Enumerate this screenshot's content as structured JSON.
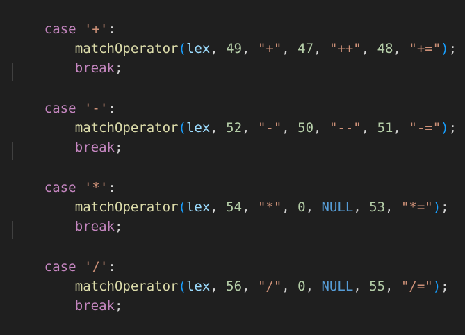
{
  "code": {
    "blocks": [
      {
        "case_keyword": "case",
        "case_char": "'+'",
        "colon": ":",
        "call": {
          "fn": "matchOperator",
          "open": "(",
          "arg1": "lex",
          "sep1": ", ",
          "n1": "49",
          "sep2": ", ",
          "s1": "\"+\"",
          "sep3": ", ",
          "n2": "47",
          "sep4": ", ",
          "s2": "\"++\"",
          "sep5": ", ",
          "n3": "48",
          "sep6": ", ",
          "s3": "\"+=\"",
          "close": ")",
          "semi": ";"
        },
        "break_keyword": "break",
        "break_semi": ";"
      },
      {
        "case_keyword": "case",
        "case_char": "'-'",
        "colon": ":",
        "call": {
          "fn": "matchOperator",
          "open": "(",
          "arg1": "lex",
          "sep1": ", ",
          "n1": "52",
          "sep2": ", ",
          "s1": "\"-\"",
          "sep3": ", ",
          "n2": "50",
          "sep4": ", ",
          "s2": "\"--\"",
          "sep5": ", ",
          "n3": "51",
          "sep6": ", ",
          "s3": "\"-=\"",
          "close": ")",
          "semi": ";"
        },
        "break_keyword": "break",
        "break_semi": ";"
      },
      {
        "case_keyword": "case",
        "case_char": "'*'",
        "colon": ":",
        "call": {
          "fn": "matchOperator",
          "open": "(",
          "arg1": "lex",
          "sep1": ", ",
          "n1": "54",
          "sep2": ", ",
          "s1": "\"*\"",
          "sep3": ", ",
          "n2": "0",
          "sep4": ", ",
          "s2": "NULL",
          "sep5": ", ",
          "n3": "53",
          "sep6": ", ",
          "s3": "\"*=\"",
          "close": ")",
          "semi": ";"
        },
        "break_keyword": "break",
        "break_semi": ";"
      },
      {
        "case_keyword": "case",
        "case_char": "'/'",
        "colon": ":",
        "call": {
          "fn": "matchOperator",
          "open": "(",
          "arg1": "lex",
          "sep1": ", ",
          "n1": "56",
          "sep2": ", ",
          "s1": "\"/\"",
          "sep3": ", ",
          "n2": "0",
          "sep4": ", ",
          "s2": "NULL",
          "sep5": ", ",
          "n3": "55",
          "sep6": ", ",
          "s3": "\"/=\"",
          "close": ")",
          "semi": ";"
        },
        "break_keyword": "break",
        "break_semi": ";"
      }
    ]
  },
  "colors": {
    "background": "#1f1f1f",
    "keyword": "#c586c0",
    "string": "#ce9178",
    "function": "#dcdcaa",
    "variable": "#9cdcfe",
    "number": "#b5cea8",
    "constant": "#569cd6",
    "bracket": "#179fff",
    "text": "#d4d4d4"
  }
}
